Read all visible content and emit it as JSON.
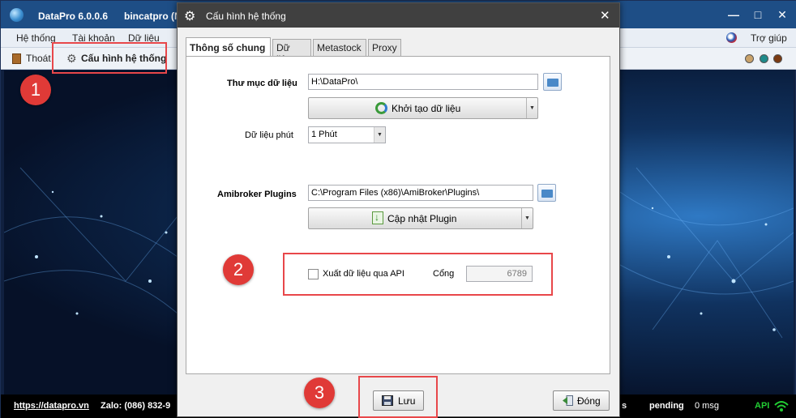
{
  "app": {
    "title": "DataPro 6.0.0.6",
    "user": "bincatpro (N",
    "minimize": "—",
    "maximize": "□",
    "close": "✕"
  },
  "menu": {
    "items": [
      "Hệ thống",
      "Tài khoản",
      "Dữ liệu"
    ],
    "help": "Trợ giúp"
  },
  "toolbar": {
    "exit_label": "Thoát",
    "config_label": "Cấu hình hệ thống"
  },
  "status_dots": [
    "#c9a26a",
    "#1e8a8a",
    "#7a3a12"
  ],
  "statusbar": {
    "website": "https://datapro.vn",
    "zalo": "Zalo: (086) 832-9",
    "partial": "s",
    "pending": "pending",
    "msg": "0 msg",
    "api": "API"
  },
  "dialog": {
    "title": "Cấu hình hệ thống",
    "close": "✕",
    "tabs": [
      "Thông số chung",
      "Dữ liệu",
      "Metastock",
      "Proxy"
    ],
    "active_tab": "Thông số chung",
    "data_folder_label": "Thư mục dữ liệu",
    "data_folder_value": "H:\\DataPro\\",
    "init_data_button": "Khởi tạo dữ liệu",
    "minute_data_label": "Dữ liệu phút",
    "minute_data_value": "1 Phút",
    "amibroker_label": "Amibroker Plugins",
    "amibroker_value": "C:\\Program Files (x86)\\AmiBroker\\Plugins\\",
    "update_plugin_button": "Cập nhật Plugin",
    "export_api_label": "Xuất dữ liệu qua API",
    "export_api_checked": false,
    "port_label": "Cổng",
    "port_value": "6789",
    "save_button": "Lưu",
    "close_button": "Đóng"
  },
  "annotations": {
    "step1": "1",
    "step2": "2",
    "step3": "3",
    "highlight_color": "#e8474a"
  }
}
